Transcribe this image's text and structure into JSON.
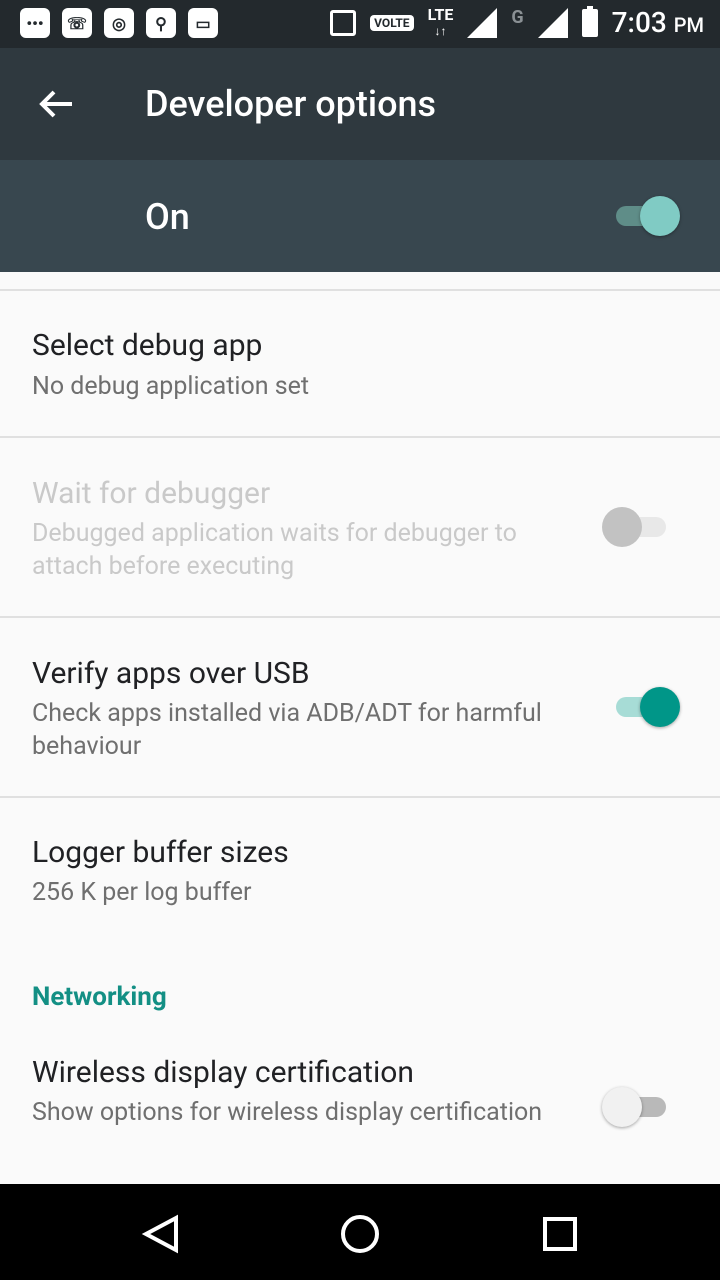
{
  "status_bar": {
    "left_icons": [
      "chat-icon",
      "whatsapp-icon",
      "instagram-icon",
      "usb-icon",
      "gallery-icon"
    ],
    "right_icons": [
      "vibrate-icon",
      "volte-badge",
      "lte-icon",
      "signal-icon",
      "g-icon",
      "signal-icon-2",
      "battery-icon"
    ],
    "volte_label": "VOLTE",
    "lte_label": "LTE",
    "g_label": "G",
    "time": "7:03",
    "ampm": "PM"
  },
  "app_bar": {
    "title": "Developer options"
  },
  "master_switch": {
    "label": "On",
    "checked": true
  },
  "settings": [
    {
      "title": "Select debug app",
      "summary": "No debug application set",
      "has_toggle": false,
      "enabled": true
    },
    {
      "title": "Wait for debugger",
      "summary": "Debugged application waits for debugger to attach before executing",
      "has_toggle": true,
      "checked": false,
      "enabled": false
    },
    {
      "title": "Verify apps over USB",
      "summary": "Check apps installed via ADB/ADT for harmful behaviour",
      "has_toggle": true,
      "checked": true,
      "enabled": true
    },
    {
      "title": "Logger buffer sizes",
      "summary": "256 K per log buffer",
      "has_toggle": false,
      "enabled": true
    }
  ],
  "section_networking": "Networking",
  "networking_settings": [
    {
      "title": "Wireless display certification",
      "summary": "Show options for wireless display certification",
      "has_toggle": true,
      "checked": false,
      "enabled": true
    }
  ],
  "colors": {
    "accent": "#009688",
    "toolbar": "#2f393f",
    "statusbar": "#23292d",
    "master_bar": "#38474f"
  }
}
